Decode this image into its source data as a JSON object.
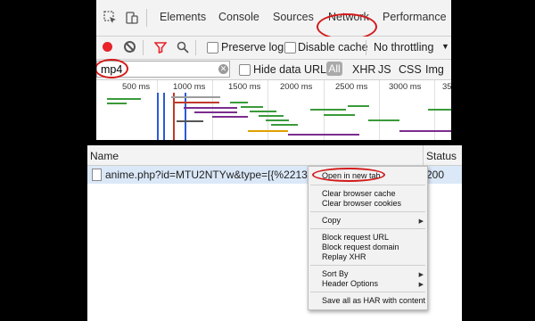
{
  "devtools": {
    "tabs": [
      {
        "label": "Elements"
      },
      {
        "label": "Console"
      },
      {
        "label": "Sources"
      },
      {
        "label": "Network"
      },
      {
        "label": "Performance"
      }
    ],
    "active_tab": "Network"
  },
  "toolbar": {
    "preserve_log": "Preserve log",
    "disable_cache": "Disable cache",
    "throttling": "No throttling"
  },
  "filter": {
    "value": "mp4",
    "hide_data_urls": "Hide data URLs",
    "types": [
      "All",
      "XHR",
      "JS",
      "CSS",
      "Img"
    ]
  },
  "timeline": {
    "ticks": [
      "500 ms",
      "1000 ms",
      "1500 ms",
      "2000 ms",
      "2500 ms",
      "3000 ms",
      "35"
    ]
  },
  "requests": {
    "columns": {
      "name": "Name",
      "status": "Status"
    },
    "rows": [
      {
        "name": "anime.php?id=MTU2NTYw&type=[{%2213%22:",
        "status": "200"
      }
    ]
  },
  "context_menu": {
    "items": [
      "Open in new tab",
      "Clear browser cache",
      "Clear browser cookies",
      "Copy",
      "Block request URL",
      "Block request domain",
      "Replay XHR",
      "Sort By",
      "Header Options",
      "Save all as HAR with content"
    ]
  },
  "colors": {
    "highlight": "#d21a1a",
    "record": "#e8232a",
    "selected_row": "#dbe8f8"
  }
}
